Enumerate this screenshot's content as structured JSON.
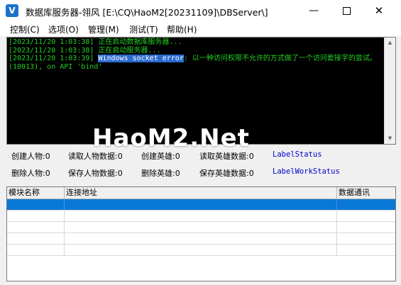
{
  "window": {
    "title": "数据库服务器-翎风  [E:\\CQ\\HaoM2[20231109]\\DBServer\\]",
    "icon": "v-logo-icon",
    "icon_glyph": "V",
    "accent": "#1a73c9",
    "minimize_glyph": "—",
    "close_glyph": "✕"
  },
  "menu": {
    "items": [
      "控制(C)",
      "选项(O)",
      "管理(M)",
      "测试(T)",
      "帮助(H)"
    ]
  },
  "log": {
    "lines": [
      {
        "prefix": "[2023/11/20 1:03:38] ",
        "text": "正在启动数据库服务器..."
      },
      {
        "prefix": "[2023/11/20 1:03:38] ",
        "text": "正在启动服务器..."
      },
      {
        "prefix": "[2023/11/20 1:03:39] ",
        "highlight": "Windows socket error",
        "text": ": 以一种访问权限不允许的方式做了一个访问套接字的尝试。 (10013), on API 'bind'"
      }
    ],
    "text_color": "#22d022",
    "background": "#000000"
  },
  "stats": {
    "row1": [
      "创建人物:0",
      "读取人物数据:0",
      "创建英雄:0",
      "读取英雄数据:0"
    ],
    "row1_status": "LabelStatus",
    "row2": [
      "删除人物:0",
      "保存人物数据:0",
      "删除英雄:0",
      "保存英雄数据:0"
    ],
    "row2_status": "LabelWorkStatus",
    "status_color": "#0000c8"
  },
  "table": {
    "columns": [
      "模块名称",
      "连接地址",
      "数据通讯"
    ],
    "selected_color": "#0a78d7"
  },
  "watermark": "HaoM2.Net"
}
